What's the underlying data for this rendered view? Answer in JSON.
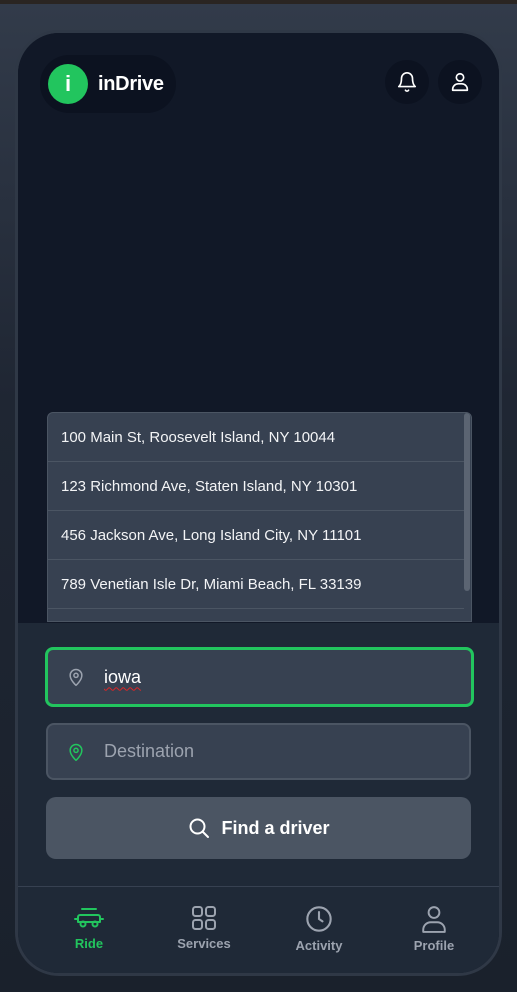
{
  "app": {
    "logo_letter": "i",
    "name": "inDrive"
  },
  "header": {
    "icons": [
      "bell-icon",
      "user-icon"
    ]
  },
  "suggestions": [
    "100 Main St, Roosevelt Island, NY 10044",
    "123 Richmond Ave, Staten Island, NY 10301",
    "456 Jackson Ave, Long Island City, NY 11101",
    "789 Venetian Isle Dr, Miami Beach, FL 33139"
  ],
  "form": {
    "origin_value": "iowa",
    "destination_placeholder": "Destination",
    "find_label": "Find a driver"
  },
  "nav": {
    "items": [
      {
        "label": "Ride",
        "icon": "car-icon",
        "active": true
      },
      {
        "label": "Services",
        "icon": "grid-icon",
        "active": false
      },
      {
        "label": "Activity",
        "icon": "clock-icon",
        "active": false
      },
      {
        "label": "Profile",
        "icon": "user-icon",
        "active": false
      }
    ]
  },
  "colors": {
    "accent": "#22c55e",
    "background": "#111827",
    "panel": "#1f2937",
    "input": "#374151"
  }
}
